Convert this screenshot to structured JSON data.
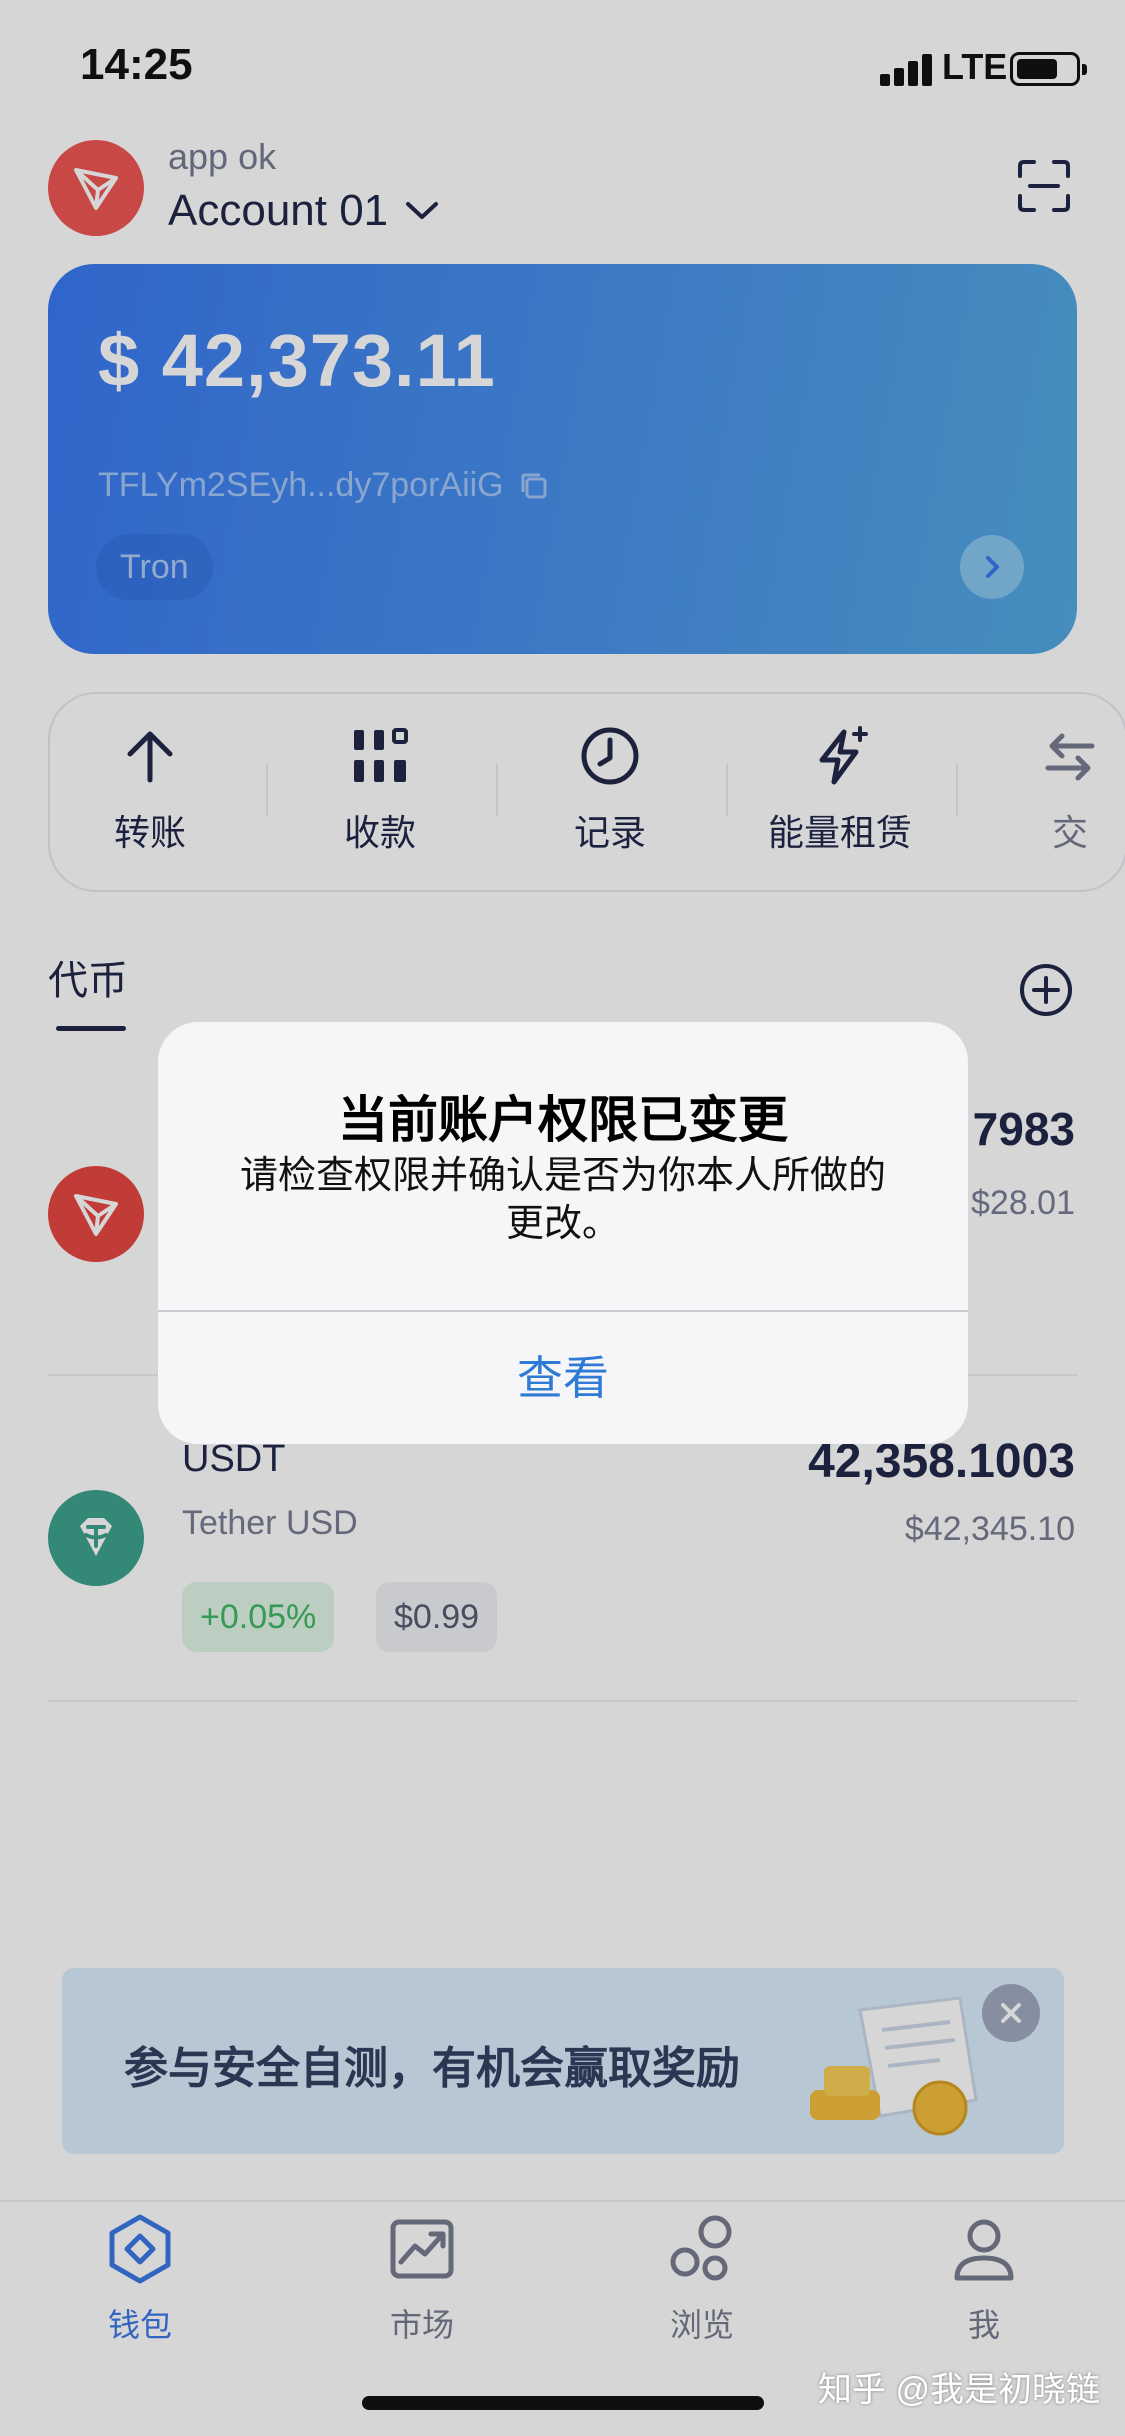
{
  "status_bar": {
    "time": "14:25",
    "network": "LTE"
  },
  "header": {
    "wallet_name": "app ok",
    "account_name": "Account 01"
  },
  "card": {
    "balance": "$ 42,373.11",
    "address": "TFLYm2SEyh...dy7porAiiG",
    "chain": "Tron"
  },
  "actions": [
    {
      "label": "转账",
      "icon": "arrow-up-icon"
    },
    {
      "label": "收款",
      "icon": "qr-code-icon"
    },
    {
      "label": "记录",
      "icon": "clock-icon"
    },
    {
      "label": "能量租赁",
      "icon": "lightning-icon"
    },
    {
      "label": "交",
      "icon": "swap-icon"
    }
  ],
  "tokens": {
    "tab_label": "代币",
    "items": [
      {
        "amount": "7983",
        "value": "$28.01"
      },
      {
        "symbol": "USDT",
        "name": "Tether USD",
        "amount": "42,358.1003",
        "value": "$42,345.10",
        "change": "+0.05%",
        "price": "$0.99"
      }
    ]
  },
  "banner": {
    "text": "参与安全自测，有机会赢取奖励"
  },
  "nav": [
    {
      "label": "钱包",
      "icon": "wallet-icon",
      "active": true
    },
    {
      "label": "市场",
      "icon": "market-chart-icon",
      "active": false
    },
    {
      "label": "浏览",
      "icon": "browse-icon",
      "active": false
    },
    {
      "label": "我",
      "icon": "profile-icon",
      "active": false
    }
  ],
  "dialog": {
    "title": "当前账户权限已变更",
    "message": "请检查权限并确认是否为你本人所做的更改。",
    "button": "查看"
  },
  "watermark": "知乎 @我是初晓链",
  "colors": {
    "card_gradient_start": "#2b6ff0",
    "card_gradient_end": "#46a3de",
    "tron_red": "#e63a33",
    "usdt_green": "#2f9b86",
    "positive": "#31b257",
    "active_nav": "#2c6fe0",
    "dialog_button": "#2e7bd6"
  }
}
